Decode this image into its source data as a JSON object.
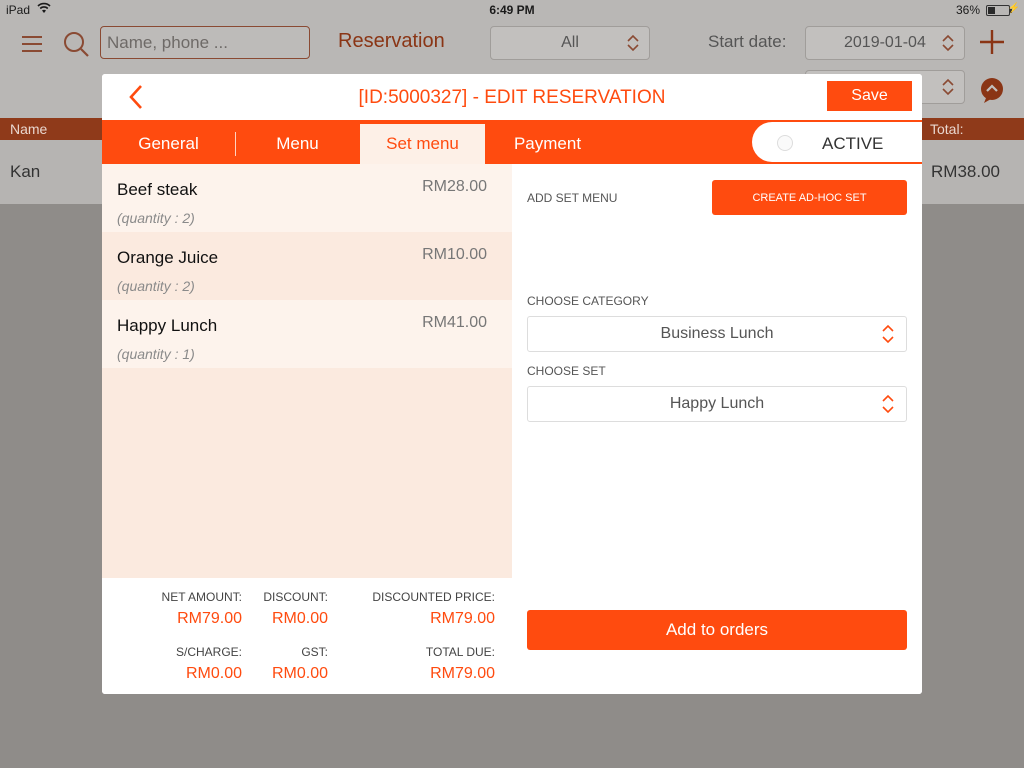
{
  "status_bar": {
    "carrier": "iPad",
    "time": "6:49 PM",
    "battery": "36%",
    "battery_level": 0.36
  },
  "background": {
    "search": {
      "placeholder": "Name, phone ..."
    },
    "title": "Reservation",
    "filter": "All",
    "start_date_label": "Start date:",
    "start_date": "2019-01-04",
    "table": {
      "headers": {
        "name": "Name",
        "total": "Total:"
      },
      "rows": [
        {
          "name": "Kan",
          "total": "RM38.00"
        }
      ]
    }
  },
  "modal": {
    "title": "[ID:5000327] - EDIT RESERVATION",
    "save_label": "Save",
    "tabs": [
      "General",
      "Menu",
      "Set menu",
      "Payment"
    ],
    "active_tab": "Set menu",
    "active_toggle_label": "ACTIVE",
    "items": [
      {
        "name": "Beef steak",
        "price": "RM28.00",
        "quantity": "(quantity : 2)"
      },
      {
        "name": "Orange Juice",
        "price": "RM10.00",
        "quantity": "(quantity : 2)"
      },
      {
        "name": "Happy Lunch",
        "price": "RM41.00",
        "quantity": "(quantity : 1)"
      }
    ],
    "totals": {
      "net_amount": {
        "label": "NET AMOUNT:",
        "value": "RM79.00"
      },
      "discount": {
        "label": "DISCOUNT:",
        "value": "RM0.00"
      },
      "discounted_price": {
        "label": "DISCOUNTED PRICE:",
        "value": "RM79.00"
      },
      "s_charge": {
        "label": "S/CHARGE:",
        "value": "RM0.00"
      },
      "gst": {
        "label": "GST:",
        "value": "RM0.00"
      },
      "total_due": {
        "label": "TOTAL DUE:",
        "value": "RM79.00"
      }
    },
    "add_set_menu_label": "ADD SET MENU",
    "create_adhoc_label": "CREATE AD-HOC SET",
    "choose_category_label": "CHOOSE CATEGORY",
    "category_value": "Business Lunch",
    "choose_set_label": "CHOOSE SET",
    "set_value": "Happy Lunch",
    "add_to_orders_label": "Add to orders"
  },
  "colors": {
    "accent": "#ff4b0f",
    "item_bg_light": "#fdf3ec",
    "item_bg_dark": "#fbeadf",
    "overlay": "#8f8c89"
  }
}
